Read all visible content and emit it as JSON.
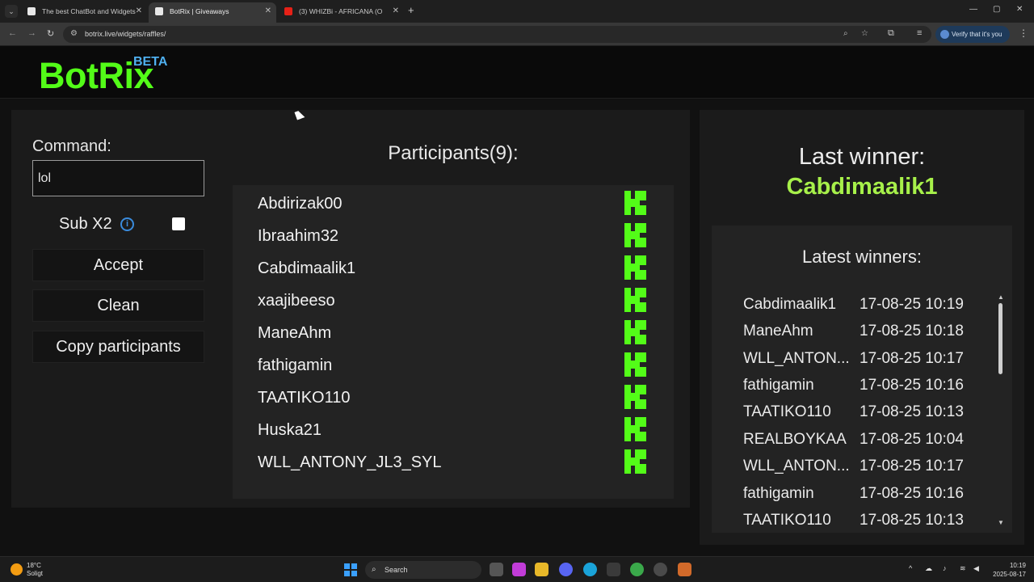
{
  "browser": {
    "tabs": [
      {
        "title": "The best ChatBot and Widgets",
        "active": false
      },
      {
        "title": "BotRix | Giveaways",
        "active": true
      },
      {
        "title": "(3) WHIZBi - AFRICANA (O",
        "active": false
      }
    ],
    "url": "botrix.live/widgets/raffles/",
    "verify_label": "Verify that it's you"
  },
  "app": {
    "logo": "BotRix",
    "badge": "BETA"
  },
  "controls": {
    "command_label": "Command:",
    "command_value": "lol",
    "sub_label": "Sub X2",
    "info_icon": "i",
    "sub_checked": false,
    "accept_label": "Accept",
    "clean_label": "Clean",
    "copy_label": "Copy participants"
  },
  "participants": {
    "title": "Participants(9):",
    "items": [
      "Abdirizak00",
      "Ibraahim32",
      "Cabdimaalik1",
      "xaajibeeso",
      "ManeAhm",
      "fathigamin",
      "TAATIKO110",
      "Huska21",
      "WLL_ANTONY_JL3_SYL"
    ],
    "platform_icon": "kick-icon",
    "icon_color": "#53fc18"
  },
  "last_winner": {
    "title": "Last winner:",
    "name": "Cabdimaalik1"
  },
  "latest_winners": {
    "title": "Latest winners:",
    "rows": [
      {
        "name": "Cabdimaalik1",
        "date": "17-08-25 10:19"
      },
      {
        "name": "ManeAhm",
        "date": "17-08-25 10:18"
      },
      {
        "name": "WLL_ANTON...",
        "date": "17-08-25 10:17"
      },
      {
        "name": "fathigamin",
        "date": "17-08-25 10:16"
      },
      {
        "name": "TAATIKO110",
        "date": "17-08-25 10:13"
      },
      {
        "name": "REALBOYKAA",
        "date": "17-08-25 10:04"
      },
      {
        "name": "WLL_ANTON...",
        "date": "17-08-25 10:17"
      },
      {
        "name": "fathigamin",
        "date": "17-08-25 10:16"
      },
      {
        "name": "TAATIKO110",
        "date": "17-08-25 10:13"
      }
    ]
  },
  "taskbar": {
    "temp": "18°C",
    "condition": "Soligt",
    "search": "Search",
    "time": "10:19",
    "date": "2025-08-17"
  },
  "colors": {
    "accent": "#53fc18",
    "winner": "#a7f04a",
    "beta": "#4fb0f0"
  }
}
